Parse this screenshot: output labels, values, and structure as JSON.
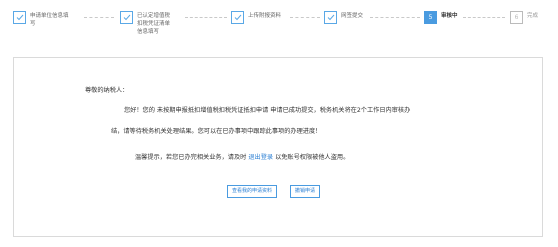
{
  "steps": [
    {
      "label_line1": "申请单位信息填",
      "label_line2": "写",
      "label_line3": "",
      "state": "done"
    },
    {
      "label_line1": "已认定增值税",
      "label_line2": "扣税凭证清单",
      "label_line3": "信息填写",
      "state": "done"
    },
    {
      "label_line1": "上传附报资料",
      "label_line2": "",
      "label_line3": "",
      "state": "done"
    },
    {
      "label_line1": "网签提交",
      "label_line2": "",
      "label_line3": "",
      "state": "done"
    },
    {
      "number": "5",
      "label_line1": "审核中",
      "label_line2": "",
      "label_line3": "",
      "state": "current"
    },
    {
      "number": "6",
      "label_line1": "完成",
      "label_line2": "",
      "label_line3": "",
      "state": "pending"
    }
  ],
  "message": {
    "greeting": "尊敬的纳税人：",
    "line1": "您好！您的 未按期申报抵扣增值税扣税凭证抵扣申请 申请已成功提交，税务机关将在2个工作日内审核办",
    "line2": "结，请等待税务机关处理结果。您可以在已办事项中跟踪此事项的办理进度！",
    "tip_prefix": "温馨提示，若您已办完相关业务，请及时",
    "tip_link": "退出登录",
    "tip_suffix": "以免账号权限被他人盗用。"
  },
  "buttons": {
    "view": "查看我的申请资料",
    "revoke": "撤销申请"
  },
  "colors": {
    "accent": "#4a9be0",
    "link": "#2a7fd4"
  }
}
